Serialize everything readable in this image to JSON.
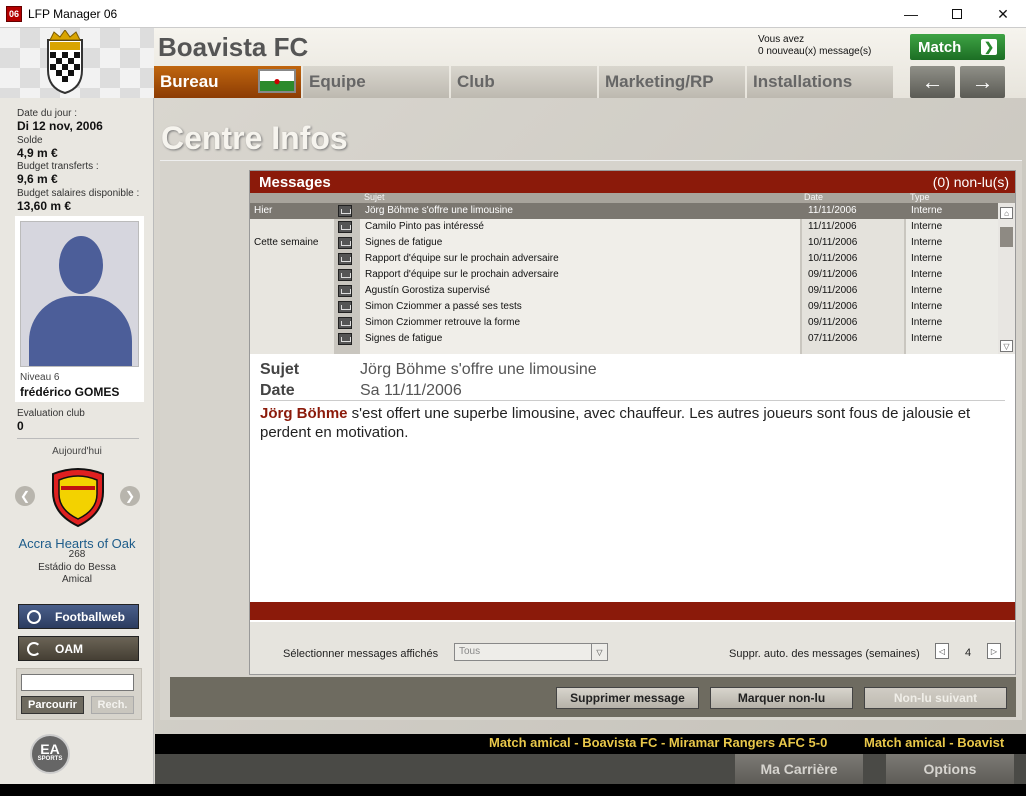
{
  "window": {
    "title": "LFP Manager 06",
    "icon_text": "06"
  },
  "header": {
    "club_name": "Boavista FC",
    "messages_notice_line1": "Vous avez",
    "messages_notice_line2": "0 nouveau(x) message(s)",
    "match_button": "Match",
    "tabs": [
      {
        "label": "Bureau",
        "active": true
      },
      {
        "label": "Equipe",
        "active": false
      },
      {
        "label": "Club",
        "active": false
      },
      {
        "label": "Marketing/RP",
        "active": false
      },
      {
        "label": "Installations",
        "active": false
      }
    ],
    "nav_back": "←",
    "nav_forward": "→"
  },
  "sidebar": {
    "date_label": "Date du jour :",
    "date_value": "Di 12 nov, 2006",
    "balance_label": "Solde",
    "balance_value": "4,9 m €",
    "transfer_budget_label": "Budget transferts :",
    "transfer_budget_value": "9,6 m €",
    "wage_budget_label": "Budget salaires disponible :",
    "wage_budget_value": "13,60 m €",
    "manager_level": "Niveau 6",
    "manager_name": "frédérico GOMES",
    "evaluation_label": "Evaluation club",
    "evaluation_value": "0",
    "today_label": "Aujourd'hui",
    "opponent_name": "Accra Hearts of Oak",
    "opponent_rank": "268",
    "stadium": "Estádio do Bessa",
    "match_type": "Amical",
    "footballweb_button": "Footballweb",
    "oam_button": "OAM",
    "search_value": "",
    "browse_button": "Parcourir",
    "search_button": "Rech.",
    "ea_logo_text": "EA",
    "ea_logo_sub": "SPORTS"
  },
  "main": {
    "title": "Centre Infos",
    "messages_header": "Messages",
    "unread_count": "(0) non-lu(s)",
    "columns": {
      "subject": "Sujet",
      "date": "Date",
      "type": "Type"
    },
    "messages": [
      {
        "group": "Hier",
        "subject": "Jörg Böhme s'offre une limousine",
        "date": "11/11/2006",
        "type": "Interne",
        "selected": true
      },
      {
        "group": "",
        "subject": "Camilo Pinto pas intéressé",
        "date": "11/11/2006",
        "type": "Interne",
        "selected": false
      },
      {
        "group": "Cette semaine",
        "subject": "Signes de fatigue",
        "date": "10/11/2006",
        "type": "Interne",
        "selected": false
      },
      {
        "group": "",
        "subject": "Rapport d'équipe sur le prochain adversaire",
        "date": "10/11/2006",
        "type": "Interne",
        "selected": false
      },
      {
        "group": "",
        "subject": "Rapport d'équipe sur le prochain adversaire",
        "date": "09/11/2006",
        "type": "Interne",
        "selected": false
      },
      {
        "group": "",
        "subject": "Agustín Gorostiza supervisé",
        "date": "09/11/2006",
        "type": "Interne",
        "selected": false
      },
      {
        "group": "",
        "subject": "Simon Cziommer a passé ses tests",
        "date": "09/11/2006",
        "type": "Interne",
        "selected": false
      },
      {
        "group": "",
        "subject": "Simon Cziommer retrouve la forme",
        "date": "09/11/2006",
        "type": "Interne",
        "selected": false
      },
      {
        "group": "",
        "subject": "Signes de fatigue",
        "date": "07/11/2006",
        "type": "Interne",
        "selected": false
      }
    ],
    "detail": {
      "subject_label": "Sujet",
      "subject_value": "Jörg Böhme s'offre une limousine",
      "date_label": "Date",
      "date_value": "Sa 11/11/2006",
      "body_name": "Jörg Böhme",
      "body_text": " s'est offert une superbe limousine, avec chauffeur. Les autres joueurs sont fous de jalousie et perdent en motivation."
    },
    "filter_label": "Sélectionner messages affichés",
    "filter_value": "Tous",
    "auto_delete_label": "Suppr. auto. des messages (semaines)",
    "auto_delete_value": "4",
    "buttons": {
      "delete": "Supprimer message",
      "mark_unread": "Marquer non-lu",
      "next_unread": "Non-lu suivant"
    }
  },
  "ticker": {
    "item1": "Match amical - Boavista FC - Miramar Rangers AFC 5-0",
    "item2": "Match amical - Boavist"
  },
  "bottom": {
    "career_button": "Ma Carrière",
    "options_button": "Options"
  },
  "colors": {
    "accent_red": "#8b1a0a",
    "tab_active": "#b5570c",
    "match_green": "#2a8a30",
    "ticker_text": "#e8c74a"
  }
}
